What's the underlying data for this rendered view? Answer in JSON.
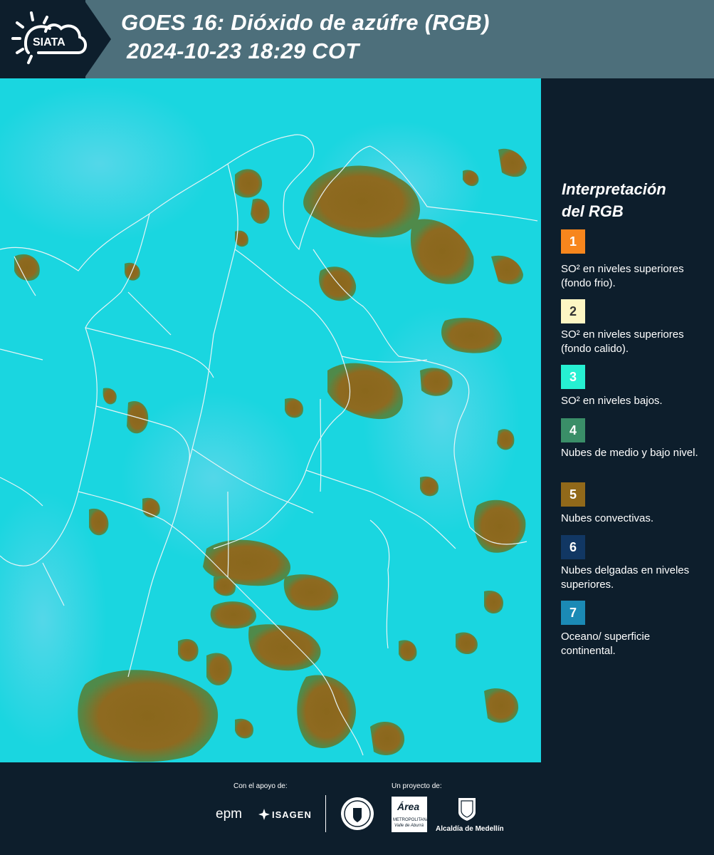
{
  "header": {
    "logo_text": "SIATA",
    "title_line1": "GOES 16: Dióxido de azúfre (RGB)",
    "title_line2": "2024-10-23 18:29 COT"
  },
  "legend": {
    "title_line1": "Interpretación",
    "title_line2": "del RGB",
    "items": [
      {
        "number": "1",
        "color": "#f7861d",
        "text": "SO² en niveles superiores (fondo frio)."
      },
      {
        "number": "2",
        "color": "#fdf6c3",
        "text": "SO² en niveles superiores (fondo calido)."
      },
      {
        "number": "3",
        "color": "#26f0d2",
        "text": "SO² en niveles bajos."
      },
      {
        "number": "4",
        "color": "#3a8e68",
        "text": "Nubes de medio y bajo nivel."
      },
      {
        "number": "5",
        "color": "#91691a",
        "text": "Nubes convectivas."
      },
      {
        "number": "6",
        "color": "#113763",
        "text": "Nubes delgadas en niveles superiores."
      },
      {
        "number": "7",
        "color": "#1b8ab5",
        "text": "Oceano/ superficie continental."
      }
    ]
  },
  "map": {
    "background_color": "#1ad6e0",
    "cloud_color": "#8e6a1e",
    "border_color": "#e6f4f6"
  },
  "footer": {
    "support_label": "Con el apoyo de:",
    "project_label": "Un proyecto de:",
    "epm": "epm",
    "isagen": "ISAGEN",
    "area_name": "Área",
    "area_sub1": "METROPOLITANA",
    "area_sub2": "Valle de Aburrá",
    "alcaldia": "Alcaldía de Medellín"
  }
}
